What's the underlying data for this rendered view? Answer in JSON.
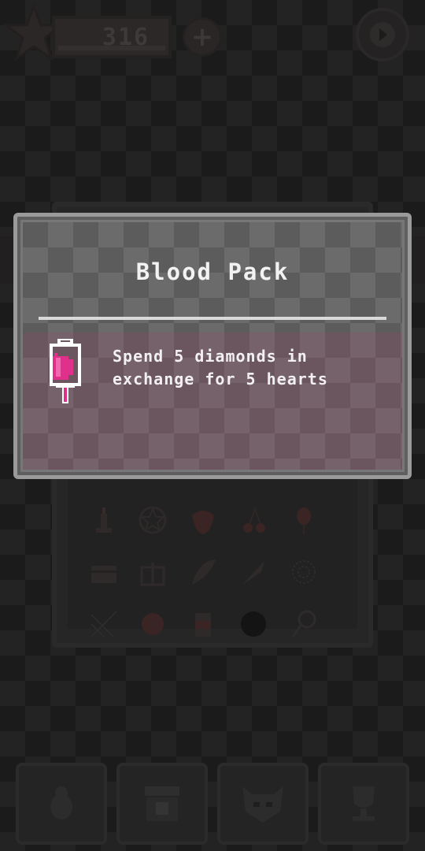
{
  "hud": {
    "score": "316",
    "star_icon": "star-icon",
    "plus_icon": "plus-icon",
    "forward_icon": "forward-icon"
  },
  "modal": {
    "title": "Blood Pack",
    "description_line1": "Spend 5 diamonds in",
    "description_line2": "exchange for 5 hearts",
    "icon": "blood-pack-icon",
    "accent_color": "#e0308c"
  },
  "inventory": {
    "items": [
      "candle-icon",
      "pentagram-icon",
      "strawberry-icon",
      "cherries-icon",
      "balloon-icon",
      "treasure-chest-icon",
      "gift-box-icon",
      "feather-icon",
      "knife-icon",
      "spiderweb-icon",
      "spiderweb-corner-icon",
      "rose-icon",
      "potion-jar-icon",
      "dark-orb-icon",
      "lollipop-icon"
    ]
  },
  "bottom_nav": {
    "items": [
      "bug-icon",
      "shop-icon",
      "monster-icon",
      "trophy-icon"
    ]
  }
}
